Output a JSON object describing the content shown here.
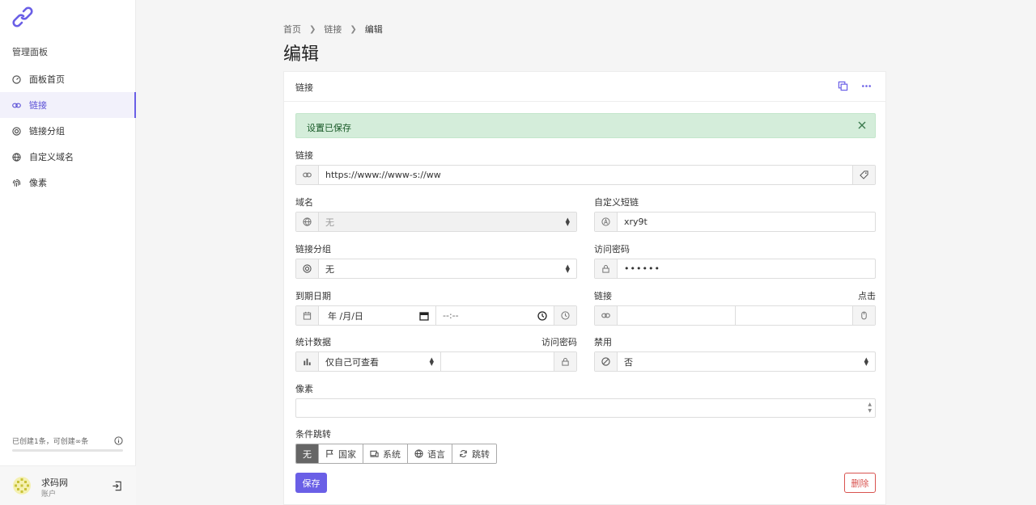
{
  "sidebar": {
    "heading": "管理面板",
    "items": [
      {
        "label": "面板首页",
        "icon": "dashboard-icon"
      },
      {
        "label": "链接",
        "icon": "link-icon",
        "active": true
      },
      {
        "label": "链接分组",
        "icon": "target-icon"
      },
      {
        "label": "自定义域名",
        "icon": "globe-icon"
      },
      {
        "label": "像素",
        "icon": "fingerprint-icon"
      }
    ],
    "quota_text": "已创建1条，可创建∞条",
    "quota_fraction": 0.0,
    "user": {
      "name": "求码网",
      "role": "账户"
    }
  },
  "breadcrumb": [
    "首页",
    "链接",
    "编辑"
  ],
  "page_title": "编辑",
  "card": {
    "title": "链接",
    "alert": "设置已保存",
    "url": {
      "label": "链接",
      "value": "https://www://www-s://ww"
    },
    "domain": {
      "label": "域名",
      "value": "无"
    },
    "alias": {
      "label": "自定义短链",
      "value": "xry9t"
    },
    "group": {
      "label": "链接分组",
      "value": "无"
    },
    "password": {
      "label": "访问密码",
      "value": "••••••"
    },
    "expiry": {
      "label": "到期日期",
      "date_placeholder": "年 /月/日",
      "time_placeholder": "--:--"
    },
    "expiry_link": {
      "label": "链接",
      "right_label": "点击"
    },
    "stats": {
      "label": "统计数据",
      "value": "仅自己可查看",
      "right_label": "访问密码"
    },
    "disabled": {
      "label": "禁用",
      "value": "否"
    },
    "pixels": {
      "label": "像素"
    },
    "targeting": {
      "label": "条件跳转",
      "options": [
        {
          "label": "无",
          "icon": "",
          "active": true
        },
        {
          "label": "国家",
          "icon": "flag-icon"
        },
        {
          "label": "系统",
          "icon": "devices-icon"
        },
        {
          "label": "语言",
          "icon": "globe-icon"
        },
        {
          "label": "跳转",
          "icon": "rotate-icon"
        }
      ]
    },
    "save_label": "保存",
    "delete_label": "删除"
  },
  "colors": {
    "accent": "#6a5fe6",
    "success_bg": "#d4edda",
    "danger": "#d9534f"
  }
}
